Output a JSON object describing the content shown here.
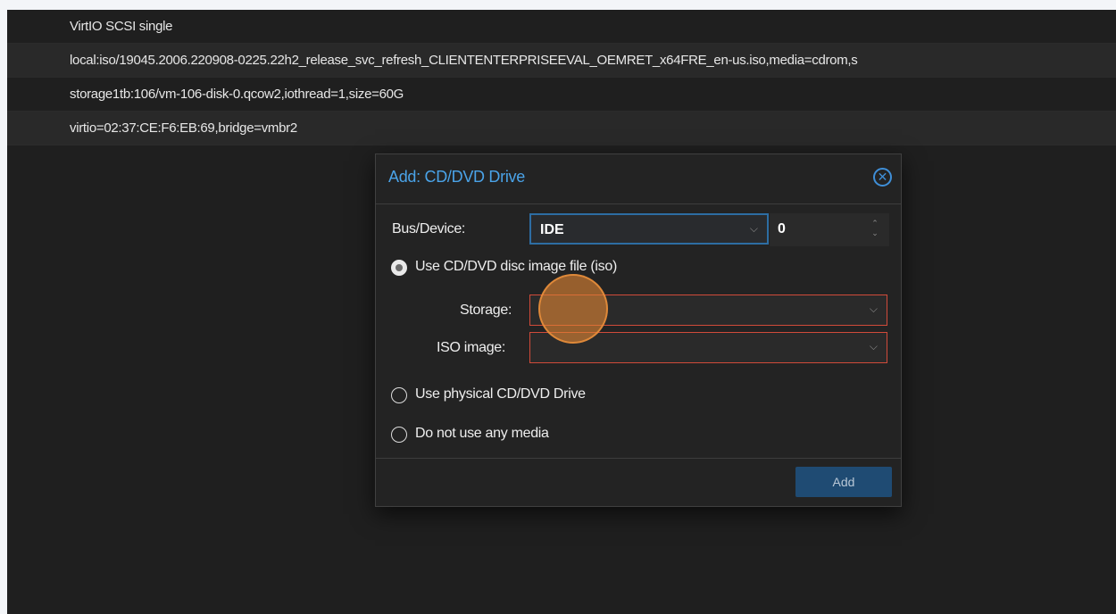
{
  "hardware_rows": [
    {
      "value": "VirtIO SCSI single"
    },
    {
      "value": "local:iso/19045.2006.220908-0225.22h2_release_svc_refresh_CLIENTENTERPRISEEVAL_OEMRET_x64FRE_en-us.iso,media=cdrom,s"
    },
    {
      "value": "storage1tb:106/vm-106-disk-0.qcow2,iothread=1,size=60G"
    },
    {
      "value": "virtio=02:37:CE:F6:EB:69,bridge=vmbr2"
    }
  ],
  "dialog": {
    "title": "Add: CD/DVD Drive",
    "close_icon": "close-circle-icon",
    "bus_device_label": "Bus/Device:",
    "bus_value": "IDE",
    "device_number": "0",
    "options": {
      "iso": "Use CD/DVD disc image file (iso)",
      "physical": "Use physical CD/DVD Drive",
      "none": "Do not use any media"
    },
    "selected_option": "iso",
    "storage_label": "Storage:",
    "storage_value": "",
    "iso_label": "ISO image:",
    "iso_value": "",
    "add_button": "Add"
  },
  "colors": {
    "accent": "#4aa3e8",
    "invalid_border": "#d14b3a",
    "button_bg": "#1f4b73",
    "cursor_highlight": "#de8534"
  }
}
